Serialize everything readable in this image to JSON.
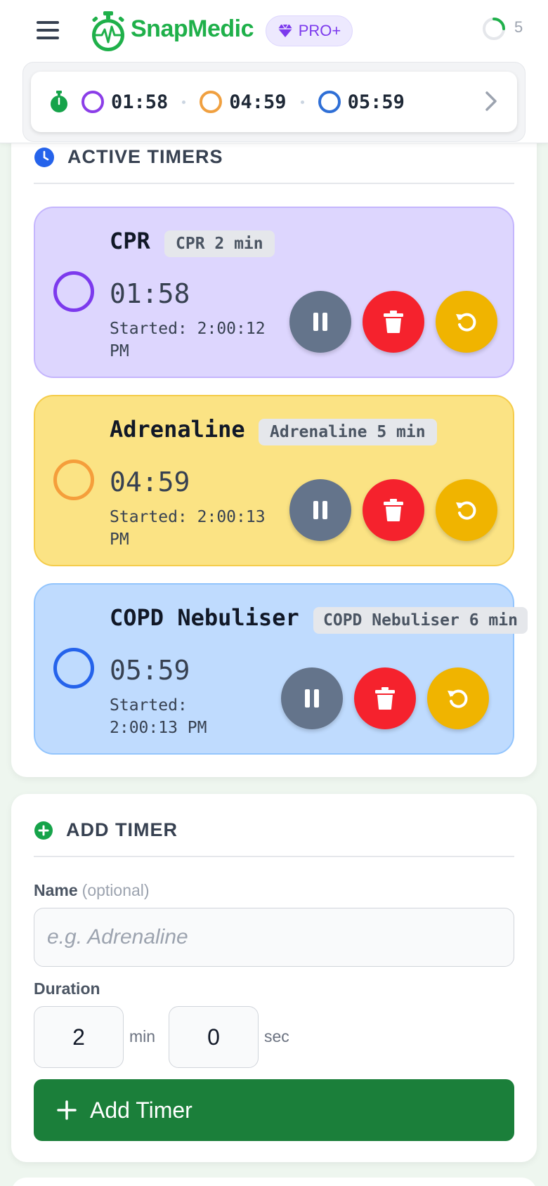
{
  "app": {
    "brand": "SnapMedic",
    "plan_badge": "PRO+",
    "active_count": "5",
    "colors": {
      "brand_green": "#1fb04a",
      "pro_purple": "#7c3aed",
      "cpr": "#7c3aed",
      "adrenaline": "#f59e3b",
      "copd": "#2563eb"
    }
  },
  "strip": {
    "items": [
      {
        "time": "01:58",
        "color": "#8b3ee8"
      },
      {
        "time": "04:59",
        "color": "#f0a040"
      },
      {
        "time": "05:59",
        "color": "#2f6fd6"
      }
    ]
  },
  "active_section": {
    "title": "ACTIVE TIMERS",
    "timers": [
      {
        "name": "CPR",
        "tag": "CPR 2 min",
        "time": "01:58",
        "started": "Started: 2:00:12 PM",
        "theme": "purple"
      },
      {
        "name": "Adrenaline",
        "tag": "Adrenaline 5 min",
        "time": "04:59",
        "started": "Started: 2:00:13 PM",
        "theme": "yellow"
      },
      {
        "name": "COPD Nebuliser",
        "tag": "COPD Nebuliser 6 min",
        "time": "05:59",
        "started": "Started: 2:00:13 PM",
        "theme": "blue"
      }
    ]
  },
  "add_section": {
    "title": "ADD TIMER",
    "name_label": "Name",
    "name_optional": "(optional)",
    "name_placeholder": "e.g. Adrenaline",
    "duration_label": "Duration",
    "minutes_value": "2",
    "minutes_unit": "min",
    "seconds_value": "0",
    "seconds_unit": "sec",
    "submit_label": "Add Timer"
  }
}
